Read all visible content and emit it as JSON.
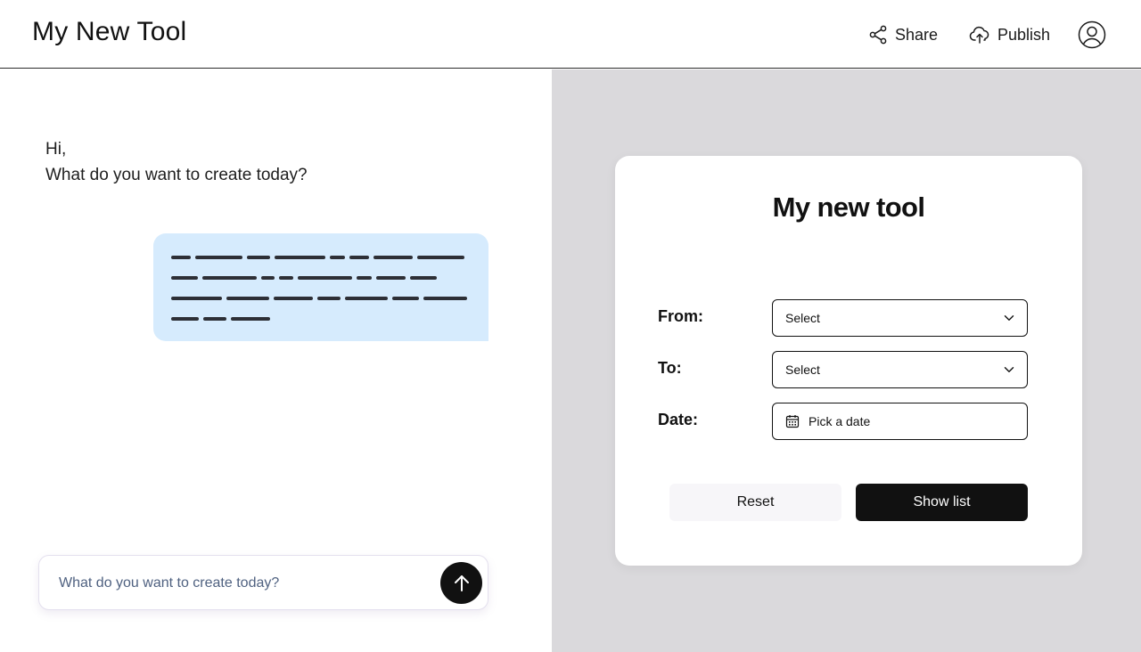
{
  "header": {
    "app_title": "My New Tool",
    "share_label": "Share",
    "publish_label": "Publish",
    "share_icon": "share-icon",
    "publish_icon": "cloud-upload-icon",
    "avatar_icon": "user-avatar-icon"
  },
  "chat": {
    "greeting_line1": "Hi,",
    "greeting_line2": "What do you want to create today?",
    "message_bubble_color": "#d6ebfd",
    "input_placeholder": "What do you want to create today?",
    "send_icon": "arrow-up-icon"
  },
  "tool_card": {
    "title": "My new tool",
    "fields": {
      "from": {
        "label": "From:",
        "value": "Select",
        "icon": "chevron-down-icon"
      },
      "to": {
        "label": "To:",
        "value": "Select",
        "icon": "chevron-down-icon"
      },
      "date": {
        "label": "Date:",
        "value": "Pick a date",
        "icon": "calendar-icon"
      }
    },
    "reset_label": "Reset",
    "show_list_label": "Show list"
  },
  "colors": {
    "preview_background": "#dad9dc",
    "primary_button": "#111111",
    "header_divider": "#2b2b2b"
  }
}
